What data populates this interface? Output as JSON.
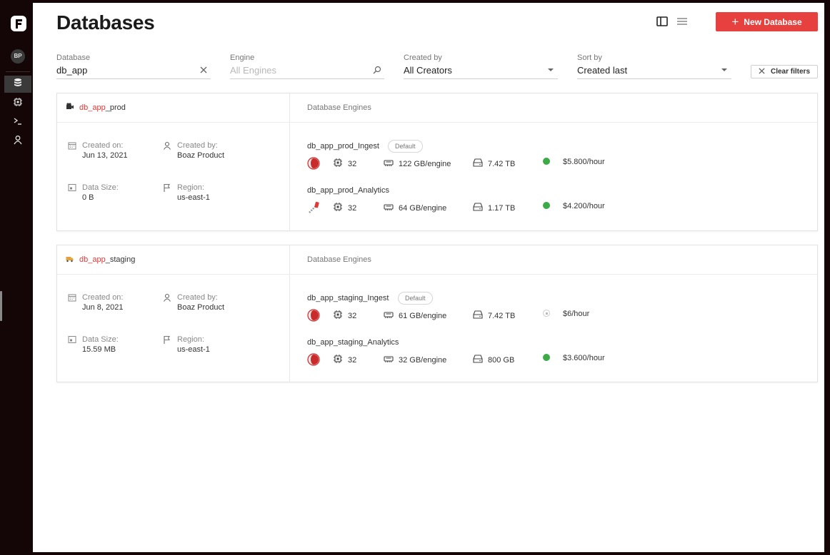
{
  "sidebar": {
    "avatar": "BP",
    "items": [
      {
        "name": "databases",
        "icon": "database-icon",
        "active": true
      },
      {
        "name": "engines",
        "icon": "chip-icon",
        "active": false
      },
      {
        "name": "sql",
        "icon": "terminal-icon",
        "active": false
      },
      {
        "name": "users",
        "icon": "user-icon",
        "active": false
      }
    ]
  },
  "header": {
    "title": "Databases",
    "new_button": "New Database"
  },
  "filters": {
    "database": {
      "label": "Database",
      "value": "db_app"
    },
    "engine": {
      "label": "Engine",
      "placeholder": "All Engines"
    },
    "created_by": {
      "label": "Created by",
      "value": "All Creators"
    },
    "sort_by": {
      "label": "Sort by",
      "value": "Created last"
    },
    "clear": "Clear filters"
  },
  "databases": [
    {
      "name_highlight": "db_app",
      "name_rest": "_prod",
      "engines_title": "Database Engines",
      "created_on_label": "Created on:",
      "created_on": "Jun 13, 2021",
      "created_by_label": "Created by:",
      "created_by": "Boaz Product",
      "data_size_label": "Data Size:",
      "data_size": "0 B",
      "region_label": "Region:",
      "region": "us-east-1",
      "engines": [
        {
          "name": "db_app_prod_Ingest",
          "badge": "Default",
          "cores": "32",
          "memory": "122 GB/engine",
          "storage": "7.42 TB",
          "status_color": "#3daa48",
          "price": "$5.800/hour"
        },
        {
          "name": "db_app_prod_Analytics",
          "badge": "",
          "cores": "32",
          "memory": "64 GB/engine",
          "storage": "1.17 TB",
          "status_color": "#3daa48",
          "price": "$4.200/hour"
        }
      ]
    },
    {
      "name_highlight": "db_app",
      "name_rest": "_staging",
      "engines_title": "Database Engines",
      "created_on_label": "Created on:",
      "created_on": "Jun 8, 2021",
      "created_by_label": "Created by:",
      "created_by": "Boaz Product",
      "data_size_label": "Data Size:",
      "data_size": "15.59 MB",
      "region_label": "Region:",
      "region": "us-east-1",
      "engines": [
        {
          "name": "db_app_staging_Ingest",
          "badge": "Default",
          "cores": "32",
          "memory": "61 GB/engine",
          "storage": "7.42 TB",
          "status_color": "#cccccc",
          "price": "$6/hour"
        },
        {
          "name": "db_app_staging_Analytics",
          "badge": "",
          "cores": "32",
          "memory": "32 GB/engine",
          "storage": "800 GB",
          "status_color": "#3daa48",
          "price": "$3.600/hour"
        }
      ]
    }
  ],
  "colors": {
    "accent": "#e6403f",
    "running": "#3daa48",
    "stopped": "#cccccc"
  }
}
